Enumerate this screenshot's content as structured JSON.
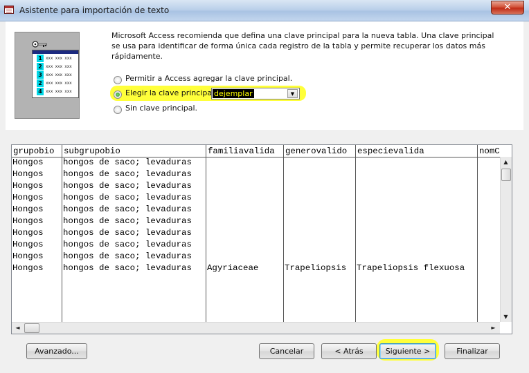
{
  "window": {
    "title": "Asistente para importación de texto",
    "close_glyph": "✕",
    "icon": "table-window-icon"
  },
  "wizard_image": {
    "icon": "primary-key-table-icon",
    "rows": [
      {
        "num": "1",
        "text": "xxx xxx xxx"
      },
      {
        "num": "2",
        "text": "xxx xxx xxx"
      },
      {
        "num": "3",
        "text": "xxx xxx xxx"
      },
      {
        "num": "2",
        "text": "xxx xxx xxx"
      },
      {
        "num": "4",
        "text": "xxx xxx xxx"
      }
    ]
  },
  "description": "Microsoft Access recomienda que defina una clave principal para la nueva tabla. Una clave principal se usa para identificar de forma única cada registro de la tabla y permite recuperar los datos más rápidamente.",
  "options": {
    "allow_access": {
      "label": "Permitir a Access agregar la clave principal.",
      "selected": false
    },
    "choose_key": {
      "label": "Elegir la clave principal.",
      "selected": true
    },
    "no_key": {
      "label": "Sin clave principal.",
      "selected": false
    }
  },
  "key_combo": {
    "value": "dejemplar",
    "arrow_glyph": "▼"
  },
  "highlight_color": "#ffff3a",
  "grid": {
    "columns": [
      "grupobio",
      "subgrupobio",
      "familiavalida",
      "generovalido",
      "especievalida",
      "nomC"
    ],
    "rows": [
      [
        "Hongos",
        "hongos de saco; levaduras",
        "",
        "",
        ""
      ],
      [
        "Hongos",
        "hongos de saco; levaduras",
        "",
        "",
        ""
      ],
      [
        "Hongos",
        "hongos de saco; levaduras",
        "",
        "",
        ""
      ],
      [
        "Hongos",
        "hongos de saco; levaduras",
        "",
        "",
        ""
      ],
      [
        "Hongos",
        "hongos de saco; levaduras",
        "",
        "",
        ""
      ],
      [
        "Hongos",
        "hongos de saco; levaduras",
        "",
        "",
        ""
      ],
      [
        "Hongos",
        "hongos de saco; levaduras",
        "",
        "",
        ""
      ],
      [
        "Hongos",
        "hongos de saco; levaduras",
        "",
        "",
        ""
      ],
      [
        "Hongos",
        "hongos de saco; levaduras",
        "",
        "",
        ""
      ],
      [
        "Hongos",
        "hongos de saco; levaduras",
        "Agyriaceae",
        "Trapeliopsis",
        "Trapeliopsis flexuosa"
      ]
    ]
  },
  "scroll": {
    "up": "▲",
    "down": "▼",
    "left": "◄",
    "right": "►"
  },
  "buttons": {
    "advanced": "Avanzado...",
    "cancel": "Cancelar",
    "back": "< Atrás",
    "next": "Siguiente >",
    "finish": "Finalizar"
  }
}
